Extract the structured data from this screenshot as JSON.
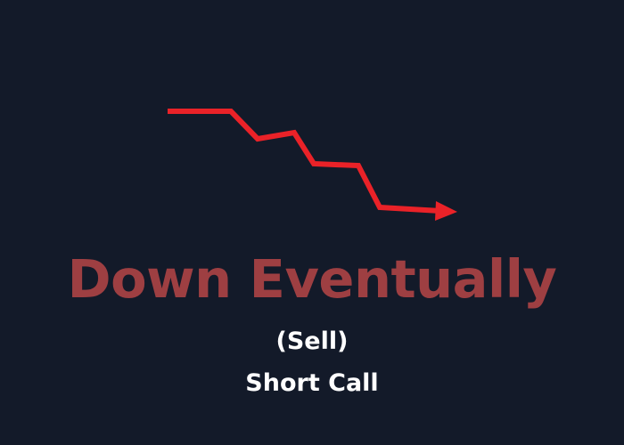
{
  "colors": {
    "background": "#131a29",
    "arrow": "#ea2228",
    "headline": "#9e3f42",
    "subtext": "#ffffff"
  },
  "graphic": {
    "icon": "downtrend-arrow-icon"
  },
  "headline": {
    "text": "Down Eventually"
  },
  "subtext": {
    "action": "(Sell)",
    "strategy": "Short Call"
  }
}
